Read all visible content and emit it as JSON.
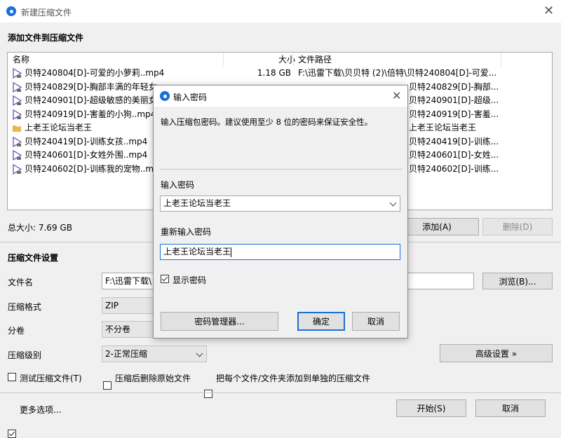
{
  "window": {
    "title": "新建压缩文件",
    "close": "✕"
  },
  "main": {
    "section_add": "添加文件到压缩文件",
    "columns": {
      "name": "名称",
      "size": "大小",
      "path": "文件路径"
    },
    "files": [
      {
        "name": "贝特240804[D]-可爱的小萝莉..mp4",
        "size": "1.18 GB",
        "path": "F:\\迅雷下载\\贝贝特 (2)\\倍特\\贝特240804[D]-可爱...",
        "type": "video"
      },
      {
        "name": "贝特240829[D]-胸部丰满的年轻女",
        "size": "",
        "path": "贝特240829[D]-胸部...",
        "type": "video"
      },
      {
        "name": "贝特240901[D]-超级敏感的美丽女",
        "size": "",
        "path": "贝特240901[D]-超级...",
        "type": "video"
      },
      {
        "name": "贝特240919[D]-害羞的小狗..mp4",
        "size": "",
        "path": "贝特240919[D]-害羞...",
        "type": "video"
      },
      {
        "name": "上老王论坛当老王",
        "size": "",
        "path": "上老王论坛当老王",
        "type": "folder"
      },
      {
        "name": "贝特240419[D]-训练女孩..mp4",
        "size": "",
        "path": "贝特240419[D]-训练...",
        "type": "video"
      },
      {
        "name": "贝特240601[D]-女姓外围..mp4",
        "size": "",
        "path": "贝特240601[D]-女姓...",
        "type": "video"
      },
      {
        "name": "贝特240602[D]-训练我的宠物..mp4",
        "size": "",
        "path": "贝特240602[D]-训练...",
        "type": "video"
      }
    ],
    "total_size": "总大小: 7.69 GB",
    "add_button": "添加(A)",
    "delete_button": "删除(D)",
    "section_settings": "压缩文件设置",
    "filename_label": "文件名",
    "filename_value": "F:\\迅雷下载\\",
    "browse_button": "浏览(B)...",
    "format_label": "压缩格式",
    "format_value": "ZIP",
    "split_label": "分卷",
    "split_value": "不分卷",
    "level_label": "压缩级别",
    "level_value": "2-正常压缩",
    "advanced_button": "高级设置 »",
    "test_checkbox": "测试压缩文件(T)",
    "delete_after_checkbox": "压缩后删除原始文件",
    "separate_checkbox": "把每个文件/文件夹添加到单独的压缩文件",
    "more_options": "更多选项...",
    "start_button": "开始(S)",
    "cancel_button": "取消"
  },
  "dialog": {
    "title": "输入密码",
    "hint": "输入压缩包密码。建议使用至少 8 位的密码来保证安全性。",
    "password_label": "输入密码",
    "password_value": "上老王论坛当老王",
    "reenter_label": "重新输入密码",
    "reenter_value": "上老王论坛当老王",
    "show_password": "显示密码",
    "manager_button": "密码管理器...",
    "ok_button": "确定",
    "cancel_button": "取消"
  },
  "colors": {
    "accent": "#1a6fd6",
    "video_icon": "#6a4fb3",
    "folder_icon": "#e8b84a"
  }
}
